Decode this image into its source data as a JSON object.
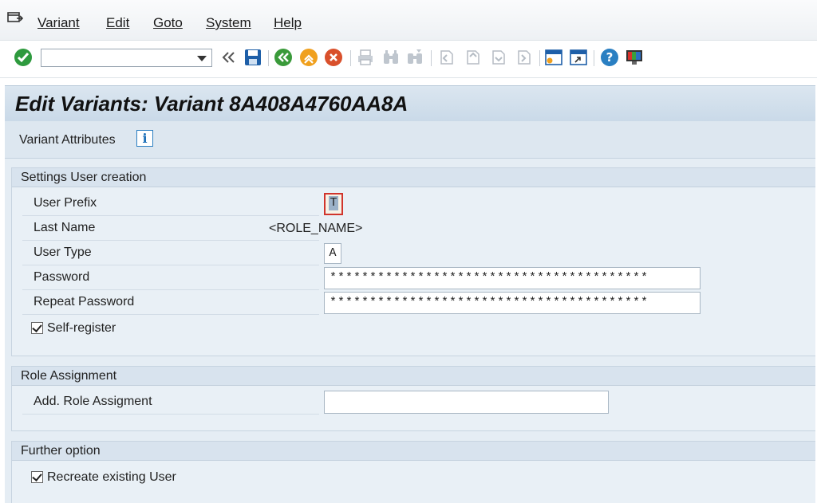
{
  "menubar": {
    "items": [
      {
        "label": "Variant"
      },
      {
        "label": "Edit"
      },
      {
        "label": "Goto"
      },
      {
        "label": "System"
      },
      {
        "label": "Help"
      }
    ]
  },
  "toolbar": {
    "command_field_value": "",
    "icons": [
      "enter-icon",
      "back-double-icon",
      "save-icon",
      "back-icon",
      "exit-icon",
      "cancel-icon",
      "print-icon",
      "find-icon",
      "find-next-icon",
      "first-page-icon",
      "previous-page-icon",
      "next-page-icon",
      "last-page-icon",
      "create-session-icon",
      "shortcut-icon",
      "help-icon",
      "customize-layout-icon"
    ],
    "colors": {
      "enter": "#2e9a3e",
      "save": "#1e5fa8",
      "back": "#3a9a3a",
      "exit": "#f0a01e",
      "cancel": "#d9502b",
      "help": "#2a7fc2"
    }
  },
  "page": {
    "title": "Edit Variants: Variant 8A408A4760AA8A"
  },
  "variant_attributes": {
    "label": "Variant Attributes",
    "info_glyph": "i"
  },
  "settings_user_creation": {
    "heading": "Settings User creation",
    "user_prefix": {
      "label": "User Prefix",
      "value": "T"
    },
    "last_name": {
      "label": "Last Name",
      "value": "<ROLE_NAME>"
    },
    "user_type": {
      "label": "User Type",
      "value": "A"
    },
    "password": {
      "label": "Password",
      "value": "****************************************"
    },
    "repeat_password": {
      "label": "Repeat Password",
      "value": "****************************************"
    },
    "self_register": {
      "label": "Self-register",
      "checked": true
    }
  },
  "role_assignment": {
    "heading": "Role Assignment",
    "add_role": {
      "label": "Add. Role Assigment",
      "value": ""
    }
  },
  "further_option": {
    "heading": "Further option",
    "recreate_user": {
      "label": "Recreate existing User",
      "checked": true
    }
  }
}
